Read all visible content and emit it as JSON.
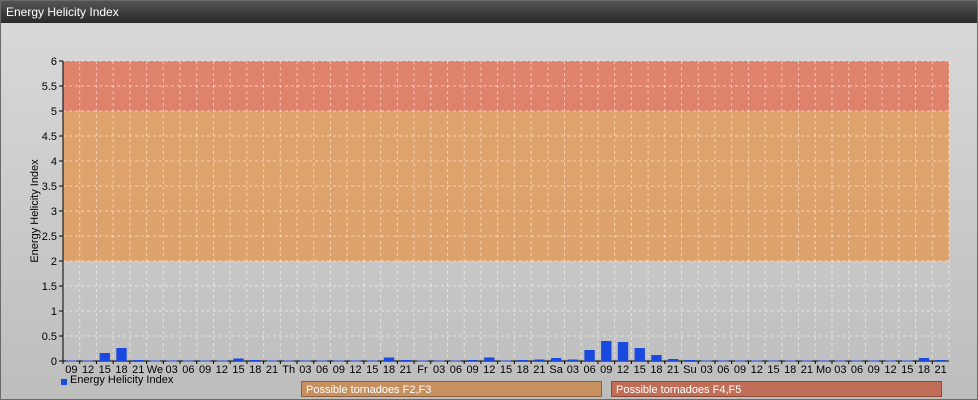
{
  "window": {
    "title": "Energy Helicity Index"
  },
  "chart_data": {
    "type": "bar",
    "ylabel": "Energy Helicity Index",
    "xlabel": "",
    "ylim": [
      0,
      6
    ],
    "yticks": [
      "0",
      "0.5",
      "1",
      "1.5",
      "2",
      "2.5",
      "3",
      "3.5",
      "4",
      "4.5",
      "5",
      "5.5",
      "6"
    ],
    "categories": [
      "09",
      "12",
      "15",
      "18",
      "21",
      "We",
      "03",
      "06",
      "09",
      "12",
      "15",
      "18",
      "21",
      "Th",
      "03",
      "06",
      "09",
      "12",
      "15",
      "18",
      "21",
      "Fr",
      "03",
      "06",
      "09",
      "12",
      "15",
      "18",
      "21",
      "Sa",
      "03",
      "06",
      "09",
      "12",
      "15",
      "18",
      "21",
      "Su",
      "03",
      "06",
      "09",
      "12",
      "15",
      "18",
      "21",
      "Mo",
      "03",
      "06",
      "09",
      "12",
      "15",
      "18",
      "21"
    ],
    "series": [
      {
        "name": "Energy Helicity Index",
        "color": "#1a49e0",
        "values": [
          0.01,
          0.01,
          0.16,
          0.26,
          0.02,
          0.01,
          0.01,
          0.01,
          0.01,
          0.01,
          0.05,
          0.02,
          0.01,
          0.01,
          0.01,
          0.01,
          0.01,
          0.01,
          0.01,
          0.07,
          0.02,
          0.01,
          0.01,
          0.01,
          0.02,
          0.07,
          0.01,
          0.02,
          0.03,
          0.06,
          0.03,
          0.22,
          0.4,
          0.38,
          0.26,
          0.12,
          0.04,
          0.02,
          0.01,
          0.01,
          0.01,
          0.01,
          0.01,
          0.01,
          0.01,
          0.01,
          0.01,
          0.01,
          0.01,
          0.01,
          0.01,
          0.06,
          0.02
        ]
      }
    ],
    "bands": [
      {
        "from": 2,
        "to": 5,
        "color": "#e09a5c",
        "label": "Possible tornadoes F2,F3"
      },
      {
        "from": 5,
        "to": 6,
        "color": "#e0745a",
        "label": "Possible tornadoes F4,F5"
      }
    ],
    "grid": true,
    "legend": "bottom-left"
  }
}
